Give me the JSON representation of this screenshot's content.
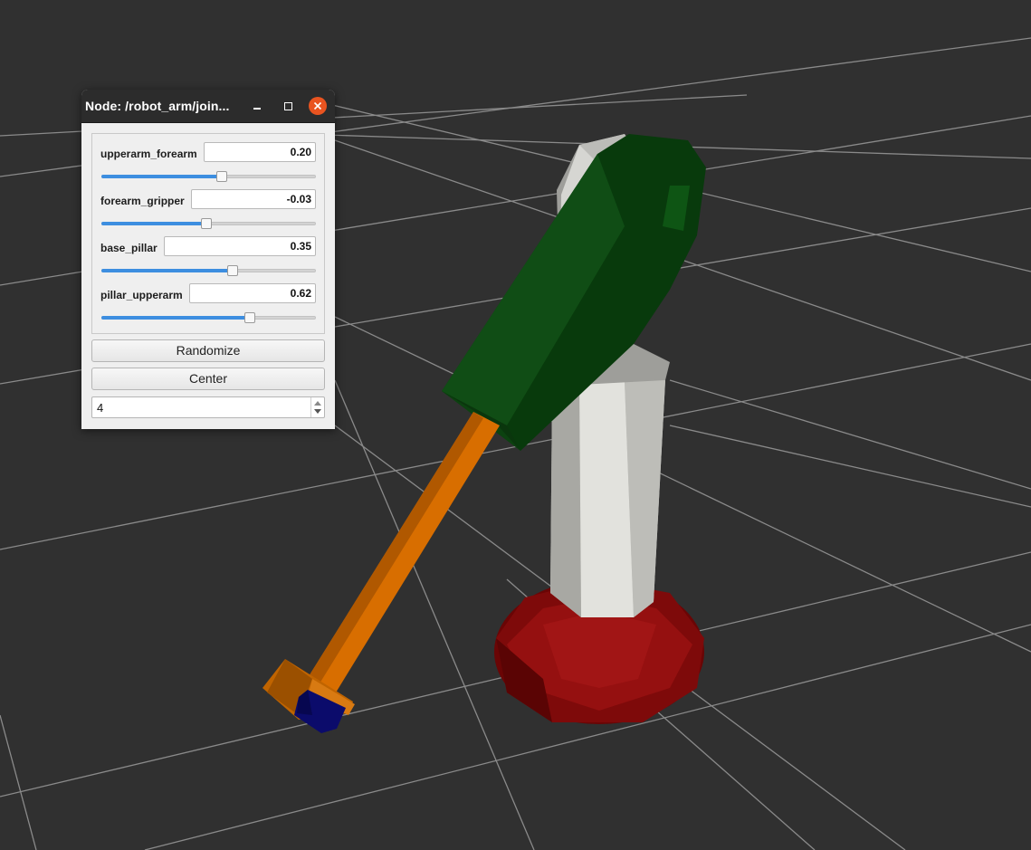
{
  "window": {
    "title": "Node: /robot_arm/join..."
  },
  "joints": [
    {
      "name": "upperarm_forearm",
      "value": "0.20",
      "slider_fraction": 0.56
    },
    {
      "name": "forearm_gripper",
      "value": "-0.03",
      "slider_fraction": 0.49
    },
    {
      "name": "base_pillar",
      "value": "0.35",
      "slider_fraction": 0.61
    },
    {
      "name": "pillar_upperarm",
      "value": "0.62",
      "slider_fraction": 0.69
    }
  ],
  "buttons": {
    "randomize_label": "Randomize",
    "center_label": "Center"
  },
  "spinbox": {
    "value": "4"
  },
  "colors": {
    "viewport_bg": "#303030",
    "grid": "#8a8a8a",
    "base": "#8b0a0a",
    "pillar": "#d8d8d4",
    "upperarm": "#0d4a12",
    "forearm": "#d86e00",
    "gripper": "#0b0b6b",
    "close_button": "#e95420",
    "slider_fill": "#3d8ee0"
  }
}
